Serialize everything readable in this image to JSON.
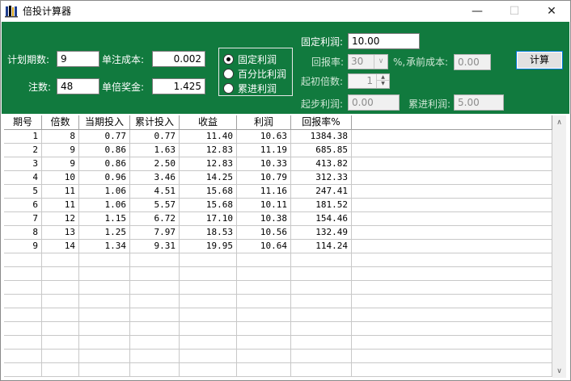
{
  "window": {
    "title": "倍投计算器",
    "minimize": "—",
    "maximize": "☐",
    "close": "✕"
  },
  "form": {
    "plan_periods_label": "计划期数:",
    "plan_periods_value": "9",
    "single_cost_label": "单注成本:",
    "single_cost_value": "0.002",
    "bets_label": "注数:",
    "bets_value": "48",
    "unit_prize_label": "单倍奖金:",
    "unit_prize_value": "1.425",
    "mode_options": [
      "固定利润",
      "百分比利润",
      "累进利润"
    ],
    "mode_selected_index": 0,
    "fixed_profit_label": "固定利润:",
    "fixed_profit_value": "10.00",
    "return_rate_label": "回报率:",
    "return_rate_value": "30",
    "percent_sign": "%,",
    "prior_cost_label": "承前成本:",
    "prior_cost_value": "0.00",
    "start_multiple_label": "起初倍数:",
    "start_multiple_value": "1",
    "start_profit_label": "起步利润:",
    "start_profit_value": "0.00",
    "progressive_profit_label": "累进利润:",
    "progressive_profit_value": "5.00",
    "calculate_label": "计算"
  },
  "table": {
    "columns": [
      "期号",
      "倍数",
      "当期投入",
      "累计投入",
      "收益",
      "利润",
      "回报率%"
    ],
    "rows": [
      [
        "1",
        "8",
        "0.77",
        "0.77",
        "11.40",
        "10.63",
        "1384.38"
      ],
      [
        "2",
        "9",
        "0.86",
        "1.63",
        "12.83",
        "11.19",
        "685.85"
      ],
      [
        "3",
        "9",
        "0.86",
        "2.50",
        "12.83",
        "10.33",
        "413.82"
      ],
      [
        "4",
        "10",
        "0.96",
        "3.46",
        "14.25",
        "10.79",
        "312.33"
      ],
      [
        "5",
        "11",
        "1.06",
        "4.51",
        "15.68",
        "11.16",
        "247.41"
      ],
      [
        "6",
        "11",
        "1.06",
        "5.57",
        "15.68",
        "10.11",
        "181.52"
      ],
      [
        "7",
        "12",
        "1.15",
        "6.72",
        "17.10",
        "10.38",
        "154.46"
      ],
      [
        "8",
        "13",
        "1.25",
        "7.97",
        "18.53",
        "10.56",
        "132.49"
      ],
      [
        "9",
        "14",
        "1.34",
        "9.31",
        "19.95",
        "10.64",
        "114.24"
      ]
    ]
  }
}
